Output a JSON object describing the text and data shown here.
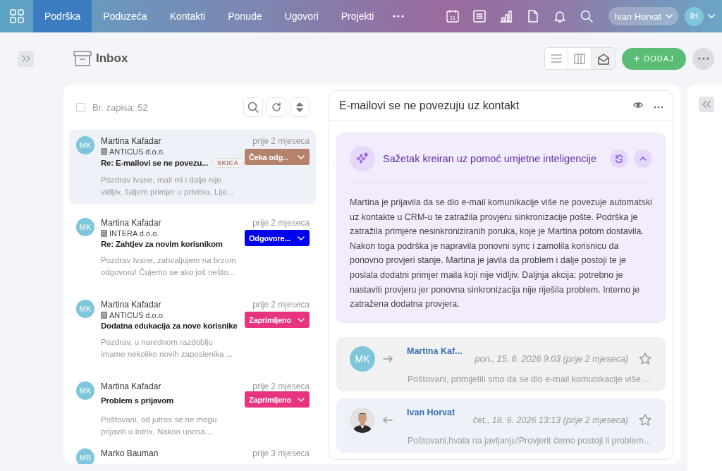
{
  "nav": {
    "tabs": [
      {
        "label": "Podrška",
        "selected": true
      },
      {
        "label": "Poduzeća",
        "selected": false
      },
      {
        "label": "Kontakti",
        "selected": false
      },
      {
        "label": "Ponude",
        "selected": false
      },
      {
        "label": "Ugovori",
        "selected": false
      },
      {
        "label": "Projekti",
        "selected": false
      }
    ],
    "calendar_day": "11",
    "user": {
      "name": "Ivan Horvat",
      "initials": "IH"
    }
  },
  "page": {
    "title": "Inbox",
    "views": [
      {
        "kind": "list",
        "selected": false
      },
      {
        "kind": "columns",
        "selected": false
      },
      {
        "kind": "mail",
        "selected": true
      }
    ],
    "add_button": "DODAJ"
  },
  "list": {
    "select_all": {
      "checked": false
    },
    "count": "Br. zapisa: 52",
    "messages": [
      {
        "initials": "MK",
        "sender": "Martina Kafadar",
        "company": "ANTICUS d.o.o.",
        "subject": "Re: E-mailovi se ne povezu...",
        "tag": "SKICA",
        "time": "prije 2 mjeseca",
        "status": {
          "label": "Čeka odg...",
          "color": "#b5836c"
        },
        "preview": [
          "Pozdrav Ivane, mail mi i dalje nije",
          "vidljiv, šaljem primjer u privitku. Lije..."
        ],
        "selected": true
      },
      {
        "initials": "MK",
        "sender": "Martina Kafadar",
        "company": "INTERA d.o.o.",
        "subject": "Re: Zahtjev za novim korisnikom",
        "time": "prije 2 mjeseca",
        "status": {
          "label": "Odgovore...",
          "color": "#0000ee"
        },
        "preview": [
          "Pozdrav Ivane, zahvaljujem na brzom",
          "odgovoru! Čujemo se ako još nešto..."
        ],
        "selected": false
      },
      {
        "initials": "MK",
        "sender": "Martina Kafadar",
        "company": "ANTICUS d.o.o.",
        "subject": "Dodatna edukacija za nove korisnike",
        "time": "prije 2 mjeseca",
        "status": {
          "label": "Zaprimljeno",
          "color": "#e8337f"
        },
        "preview": [
          "Pozdrav, u narednom razdoblju",
          "imamo nekoliko novih zaposlenika ..."
        ],
        "selected": false
      },
      {
        "initials": "MK",
        "sender": "Martina Kafadar",
        "subject": "Problem s prijavom",
        "time": "prije 2 mjeseca",
        "status": {
          "label": "Zaprimljeno",
          "color": "#e8337f"
        },
        "preview": [
          "Poštovani, od jutros se ne mogu",
          "prijaviti u Intrix. Nakon unosa..."
        ],
        "selected": false
      },
      {
        "initials": "MB",
        "sender": "Marko Bauman",
        "time": "prije 3 mjeseca",
        "selected": false
      }
    ]
  },
  "detail": {
    "title": "E-mailovi se ne povezuju uz kontakt",
    "summary": {
      "title": "Sažetak kreiran uz pomoć umjetne inteligencije",
      "expanded": true,
      "text": "Martina je prijavila da se dio e-mail komunikacije više ne povezuje automatski uz kontakte u CRM-u te zatražila provjeru sinkronizacije pošte. Podrška je zatražila primjere nesinkroniziranih poruka, koje je Martina potom dostavila. Nakon toga podrška je napravila ponovni sync i zamolila korisnicu da ponovno provjeri stanje. Martina je javila da problem i dalje postoji te je poslala dodatni primjer maila koji nije vidljiv. Daljnja akcija: potrebno je nastaviti provjeru jer ponovna sinkronizacija nije riješila problem. Interno je zatražena dodatna provjera."
    },
    "thread": [
      {
        "avatar": {
          "kind": "initials",
          "text": "MK"
        },
        "kind": "incoming",
        "sender": "Martina Kaf...",
        "date": "pon., 15. 6. 2026 9:03 (prije 2 mjeseca)",
        "starred": false,
        "preview": "Poštovani, primijetili smo da se dio e-mail komunikacije više ..."
      },
      {
        "kind": "outgoing",
        "sender": "Ivan Horvat",
        "date": "čet., 18. 6. 2026 13:13 (prije 2 mjeseca)",
        "starred": false,
        "preview": "Poštovani,hvala na javljanju!Provjerit ćemo postoji li problem..."
      }
    ]
  }
}
